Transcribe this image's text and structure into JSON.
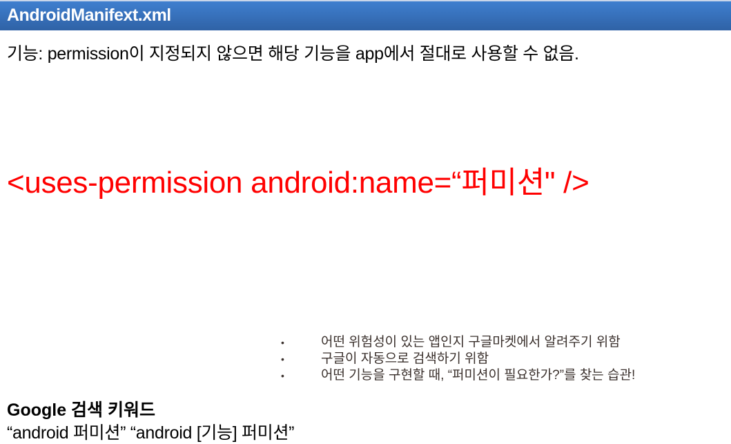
{
  "header": {
    "title": "AndroidManifext.xml"
  },
  "description": "기능: permission이 지정되지 않으면 해당 기능을 app에서 절대로 사용할 수 없음.",
  "code_line": "<uses-permission android:name=“퍼미션\" />",
  "bullets": [
    "어떤 위험성이 있는 앱인지 구글마켓에서 알려주기 위함",
    "구글이 자동으로 검색하기 위함",
    "어떤 기능을 구현할 때, “퍼미션이 필요한가?”를 찾는 습관!"
  ],
  "keywords": {
    "title": "Google 검색 키워드",
    "text": "“android 퍼미션” “android [기능] 퍼미션”"
  }
}
